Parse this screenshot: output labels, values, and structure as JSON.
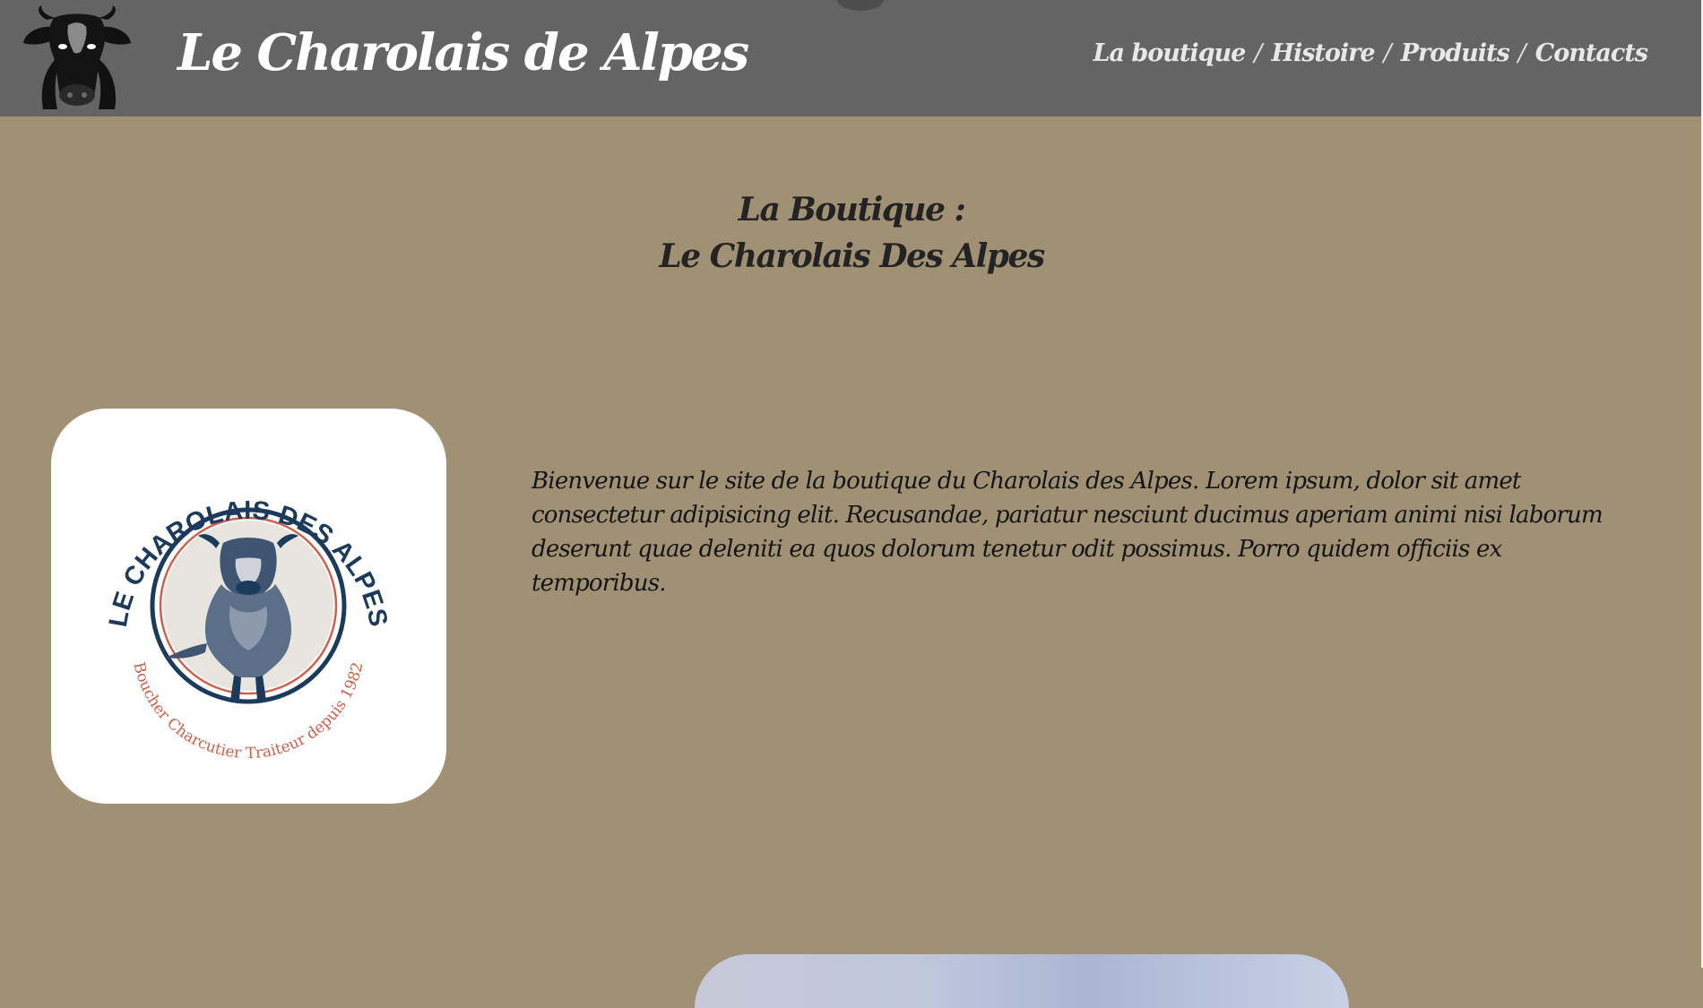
{
  "header": {
    "site_title": "Le Charolais de Alpes",
    "logo_icon": "cow-head-icon",
    "nav": [
      {
        "label": "La boutique"
      },
      {
        "label": "Histoire"
      },
      {
        "label": "Produits"
      },
      {
        "label": "Contacts"
      }
    ],
    "nav_separator": "/"
  },
  "main": {
    "heading_line1": "La Boutique :",
    "heading_line2": "Le Charolais Des Alpes",
    "intro_text": "Bienvenue sur le site de la boutique du Charolais des Alpes. Lorem ipsum, dolor sit amet consectetur adipisicing elit. Recusandae, pariatur nesciunt ducimus aperiam animi nisi laborum deserunt quae deleniti ea quos dolorum tenetur odit possimus. Porro quidem officiis ex temporibus.",
    "brand_logo": {
      "top_text": "LE CHAROLAIS DES ALPES",
      "bottom_text": "Boucher Charcutier Traiteur depuis 1982"
    }
  },
  "colors": {
    "header_bg": "#646464",
    "page_bg": "#a09175",
    "logo_navy": "#1c3a5c",
    "logo_red": "#d0604a"
  }
}
